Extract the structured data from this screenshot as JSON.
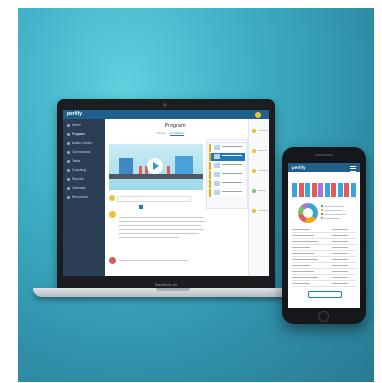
{
  "laptop": {
    "brand_label": "MacBook Air",
    "app": {
      "logo": "perlify",
      "user_name": "",
      "page_title": "Program",
      "tabs": [
        "Home",
        "Curriculum"
      ],
      "sidebar_items": [
        {
          "label": "Home",
          "active": false
        },
        {
          "label": "Program",
          "active": true
        },
        {
          "label": "Action Center",
          "active": false
        },
        {
          "label": "Connections",
          "active": false
        },
        {
          "label": "Tasks",
          "active": false
        },
        {
          "label": "Coaching",
          "active": false
        },
        {
          "label": "Reports",
          "active": false
        },
        {
          "label": "Calendar",
          "active": false
        },
        {
          "label": "Resources",
          "active": false
        }
      ],
      "playlist_header": "",
      "ask_placeholder": "",
      "filters": []
    }
  },
  "phone": {
    "logo": "perlify"
  },
  "colors": {
    "background": "#3fb0c6",
    "app_primary": "#1f5f8b",
    "sidebar": "#2c3e55",
    "accent_yellow": "#f1c232",
    "accent_red": "#e15b5b"
  }
}
